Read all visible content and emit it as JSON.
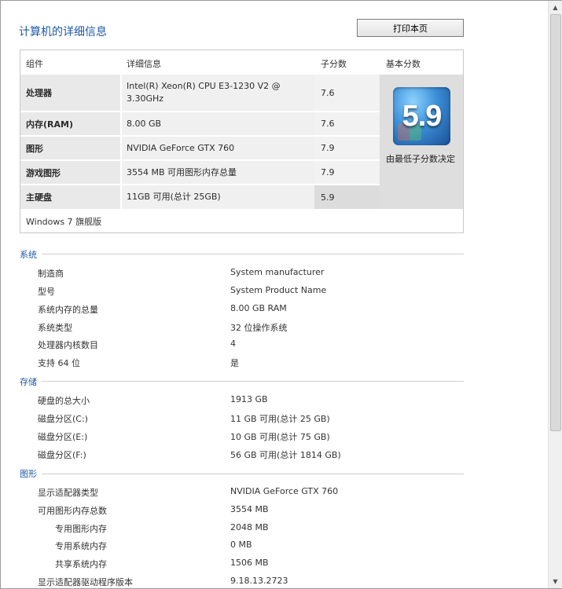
{
  "header": {
    "title": "计算机的详细信息",
    "print_label": "打印本页"
  },
  "score_table": {
    "columns": {
      "component": "组件",
      "details": "详细信息",
      "subscore": "子分数",
      "base": "基本分数"
    },
    "rows": [
      {
        "component": "处理器",
        "details": "Intel(R) Xeon(R) CPU E3-1230 V2 @ 3.30GHz",
        "subscore": "7.6"
      },
      {
        "component": "内存(RAM)",
        "details": "8.00 GB",
        "subscore": "7.6"
      },
      {
        "component": "图形",
        "details": "NVIDIA GeForce GTX 760",
        "subscore": "7.9"
      },
      {
        "component": "游戏图形",
        "details": "3554 MB 可用图形内存总量",
        "subscore": "7.9"
      },
      {
        "component": "主硬盘",
        "details": "11GB 可用(总计 25GB)",
        "subscore": "5.9"
      }
    ],
    "base_score": "5.9",
    "base_note": "由最低子分数决定",
    "edition": "Windows 7 旗舰版"
  },
  "system": {
    "title": "系统",
    "items": [
      {
        "label": "制造商",
        "value": "System manufacturer"
      },
      {
        "label": "型号",
        "value": "System Product Name"
      },
      {
        "label": "系统内存的总量",
        "value": "8.00 GB RAM"
      },
      {
        "label": "系统类型",
        "value": "32 位操作系统"
      },
      {
        "label": "处理器内核数目",
        "value": "4"
      },
      {
        "label": "支持 64 位",
        "value": "是"
      }
    ]
  },
  "storage": {
    "title": "存储",
    "items": [
      {
        "label": "硬盘的总大小",
        "value": "1913 GB"
      },
      {
        "label": "磁盘分区(C:)",
        "value": "11 GB 可用(总计 25 GB)"
      },
      {
        "label": "磁盘分区(E:)",
        "value": "10 GB 可用(总计 75 GB)"
      },
      {
        "label": "磁盘分区(F:)",
        "value": "56 GB 可用(总计 1814 GB)"
      }
    ]
  },
  "graphics": {
    "title": "图形",
    "items": [
      {
        "label": "显示适配器类型",
        "value": "NVIDIA GeForce GTX 760"
      },
      {
        "label": "可用图形内存总数",
        "value": "3554 MB"
      },
      {
        "label": "专用图形内存",
        "value": "2048 MB"
      },
      {
        "label": "专用系统内存",
        "value": "0 MB"
      },
      {
        "label": "共享系统内存",
        "value": "1506 MB"
      },
      {
        "label": "显示适配器驱动程序版本",
        "value": "9.18.13.2723"
      }
    ]
  },
  "icons": {
    "scroll_up": "arrow-up-icon",
    "scroll_down": "arrow-down-icon",
    "score_badge": "windows-experience-badge-icon"
  }
}
